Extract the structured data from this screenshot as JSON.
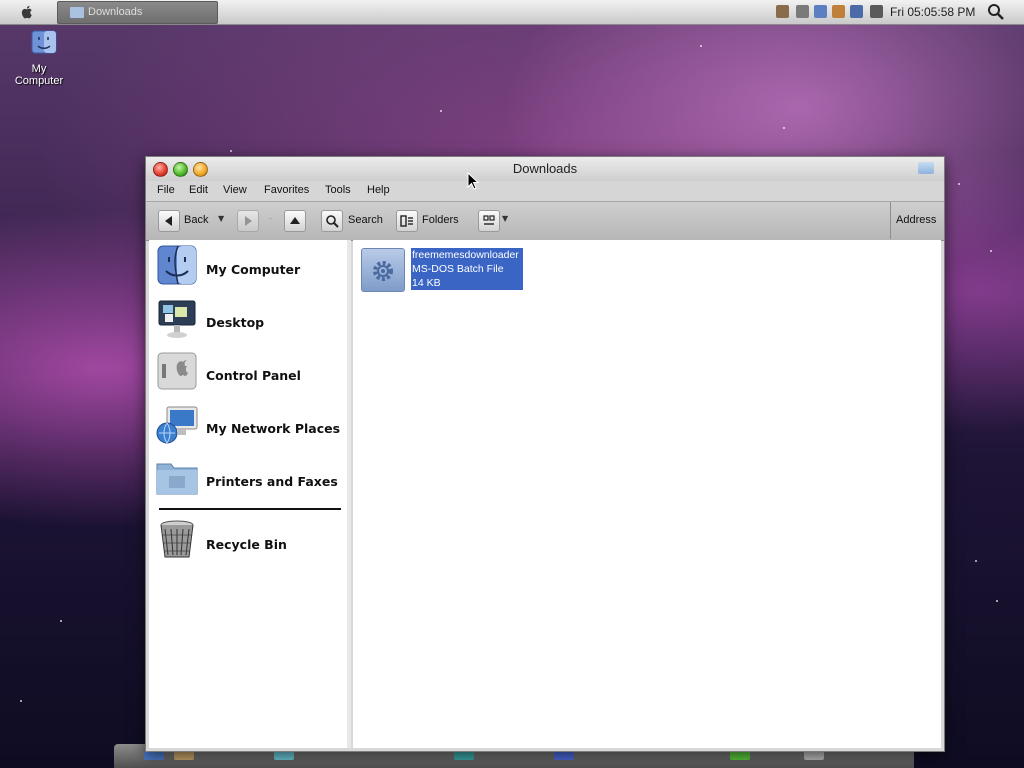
{
  "menubar": {
    "taskbar_item": "Downloads",
    "clock": "Fri 05:05:58 PM"
  },
  "desktop": {
    "icons": [
      {
        "label": "My Computer",
        "icon": "finder-icon"
      }
    ]
  },
  "window": {
    "title": "Downloads",
    "menu": [
      "File",
      "Edit",
      "View",
      "Favorites",
      "Tools",
      "Help"
    ],
    "toolbar": {
      "back_label": "Back",
      "search_label": "Search",
      "folders_label": "Folders",
      "address_label": "Address"
    },
    "sidebar": {
      "items": [
        {
          "label": "My Computer",
          "icon": "finder-icon"
        },
        {
          "label": "Desktop",
          "icon": "desktop-icon"
        },
        {
          "label": "Control Panel",
          "icon": "control-panel-icon"
        },
        {
          "label": "My Network Places",
          "icon": "network-icon"
        },
        {
          "label": "Printers and Faxes",
          "icon": "printer-folder-icon"
        },
        {
          "label": "Recycle Bin",
          "icon": "trash-icon"
        }
      ]
    },
    "files": [
      {
        "name": "freememesdownloader",
        "type": "MS-DOS Batch File",
        "size": "14 KB",
        "icon": "batch-file-gear-icon",
        "selected": true
      }
    ]
  },
  "colors": {
    "selection": "#3a65c4",
    "close": "#e1392b",
    "minimize": "#4cb826",
    "maximize": "#f1a522"
  }
}
